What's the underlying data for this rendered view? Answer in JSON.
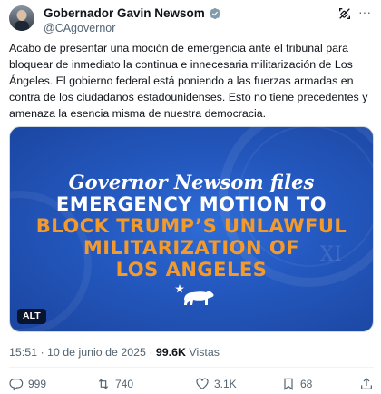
{
  "author": {
    "name": "Gobernador Gavin Newsom",
    "handle": "@CAgovernor"
  },
  "tweet": {
    "text": "Acabo de presentar una moción de emergencia ante el tribunal para bloquear de inmediato la continua e innecesaria militarización de Los Ángeles. El gobierno federal está poniendo a las fuerzas armadas en contra de los ciudadanos estadounidenses. Esto no tiene precedentes y amenaza la esencia misma de nuestra democracia."
  },
  "media": {
    "line1": "Governor Newsom files",
    "line2": "EMERGENCY MOTION TO",
    "line3": "BLOCK TRUMP’S UNLAWFUL",
    "line4": "MILITARIZATION OF",
    "line5": "LOS ANGELES",
    "seal_numeral": "XI",
    "alt_label": "ALT"
  },
  "meta": {
    "timestamp": "15:51 · 10 de junio de 2025 · ",
    "views_count": "99.6K",
    "views_label": " Vistas"
  },
  "actions": {
    "replies": "999",
    "reposts": "740",
    "likes": "3.1K",
    "bookmarks": "68"
  },
  "icons": {
    "verified": "verified-badge-icon",
    "grok": "grok-icon",
    "more": "more-icon",
    "reply": "reply-icon",
    "repost": "repost-icon",
    "like": "heart-icon",
    "bookmark": "bookmark-icon",
    "share": "share-icon"
  },
  "colors": {
    "accent_blue": "#1d9bf0",
    "media_blue": "#2459c0",
    "media_orange": "#f39a2a",
    "text_secondary": "#536471"
  }
}
